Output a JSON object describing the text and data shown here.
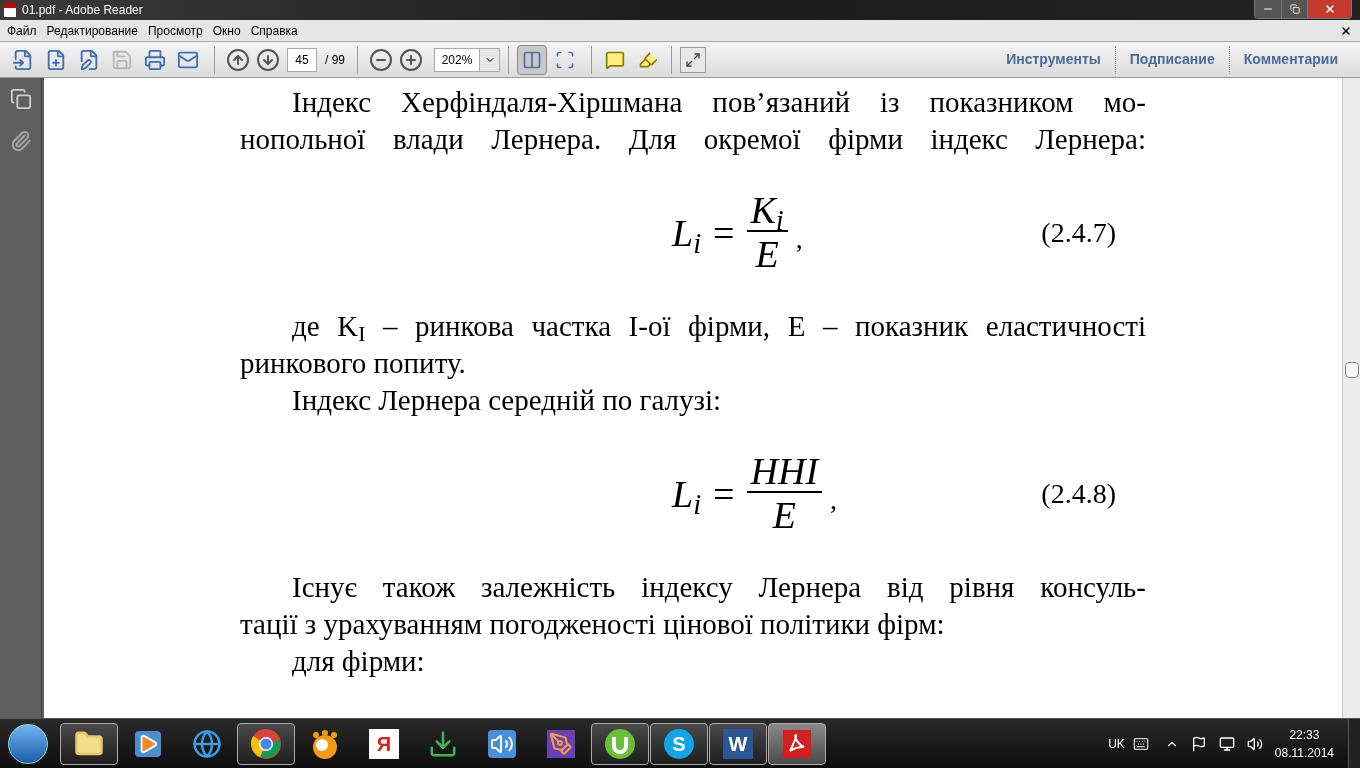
{
  "window": {
    "title": "01.pdf - Adobe Reader"
  },
  "menu": [
    "Файл",
    "Редактирование",
    "Просмотр",
    "Окно",
    "Справка"
  ],
  "toolbar": {
    "file_buttons": [
      {
        "disabled": false
      },
      {
        "disabled": false
      },
      {
        "disabled": false
      },
      {
        "disabled": true
      },
      {
        "disabled": false
      },
      {
        "disabled": false
      }
    ],
    "page": "45",
    "page_total": "/ 99",
    "zoom": "202%",
    "view_buttons": [
      {
        "selected": true
      },
      {
        "selected": false
      }
    ],
    "panes": [
      "Инструменты",
      "Подписание",
      "Комментарии"
    ]
  },
  "document": {
    "blocks": [
      {
        "kind": "line",
        "indent": true,
        "full": true,
        "text": "Індекс Херфіндаля-Хіршмана пов’язаний із показником мо-"
      },
      {
        "kind": "line",
        "indent": false,
        "full": true,
        "text": "нопольної влади Лернера. Для окремої фірми індекс Лернера:"
      },
      {
        "kind": "formula",
        "lhs": "L$_{i}$",
        "eq": "=",
        "numerator": "K$_{i}$",
        "denominator": "E",
        "tail": ",",
        "number": "(2.4.7)"
      },
      {
        "kind": "line",
        "indent": true,
        "full": true,
        "text": "де K$_{I}$ – ринкова частка I-ої фірми, E – показник еластичності"
      },
      {
        "kind": "line",
        "indent": false,
        "full": false,
        "text": "ринкового попиту."
      },
      {
        "kind": "line",
        "indent": true,
        "full": false,
        "text": "Індекс Лернера середній по галузі:"
      },
      {
        "kind": "formula",
        "lhs": "L$_{i}$",
        "eq": "=",
        "numerator": "HHI",
        "denominator": "E",
        "tail": ",",
        "number": "(2.4.8)"
      },
      {
        "kind": "line",
        "indent": true,
        "full": true,
        "text": "Існує також залежність індексу Лернера від рівня консуль-"
      },
      {
        "kind": "line",
        "indent": false,
        "full": false,
        "text": "тації з урахуванням погодженості цінової політики фірм:"
      },
      {
        "kind": "line",
        "indent": true,
        "full": false,
        "text": "для фірми:"
      }
    ]
  },
  "taskbar": {
    "items": [
      {
        "running": true,
        "selected": false
      },
      {
        "running": false,
        "selected": false
      },
      {
        "running": false,
        "selected": false
      },
      {
        "running": true,
        "selected": false
      },
      {
        "running": false,
        "selected": false
      },
      {
        "running": false,
        "selected": false,
        "label": "Я"
      },
      {
        "running": false,
        "selected": false
      },
      {
        "running": false,
        "selected": false
      },
      {
        "running": false,
        "selected": false
      },
      {
        "running": true,
        "selected": false
      },
      {
        "running": true,
        "selected": false,
        "label": "S"
      },
      {
        "running": true,
        "selected": false,
        "label": "W"
      },
      {
        "running": true,
        "selected": true
      }
    ],
    "language": "UK",
    "time": "22:33",
    "date": "08.11.2014"
  }
}
